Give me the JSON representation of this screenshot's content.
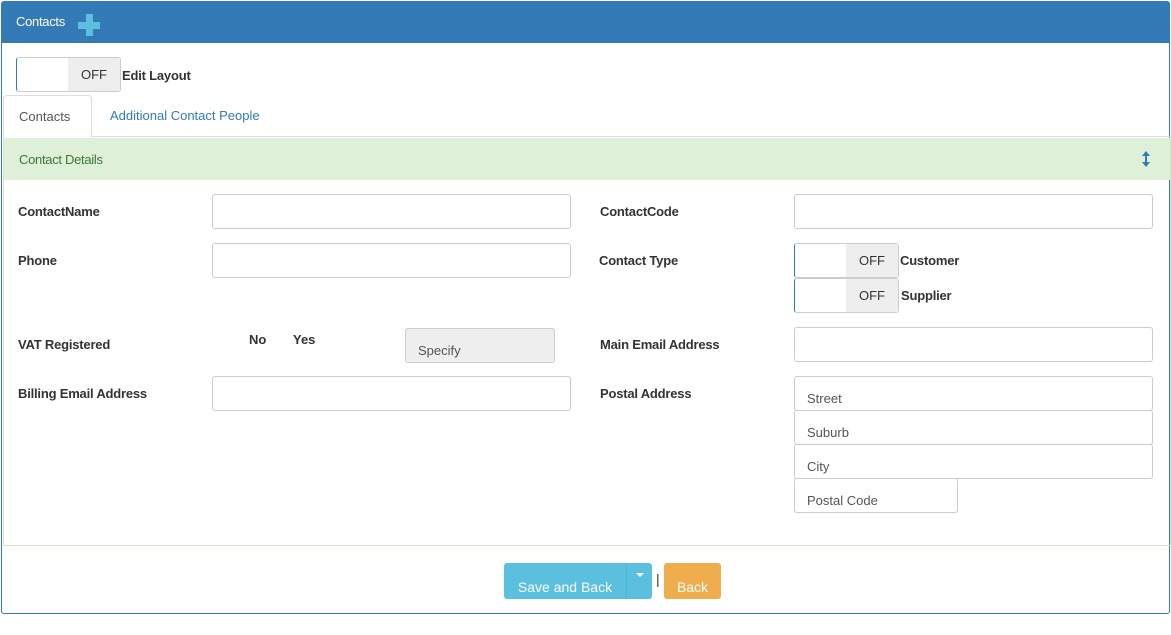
{
  "header": {
    "title": "Contacts",
    "add_icon": "plus-icon"
  },
  "edit_layout": {
    "state": "OFF",
    "label": "Edit Layout"
  },
  "tabs": [
    {
      "label": "Contacts",
      "active": true
    },
    {
      "label": "Additional Contact People",
      "active": false
    }
  ],
  "section": {
    "title": "Contact Details",
    "toggle_icon": "resize-vertical-icon"
  },
  "form": {
    "contact_name": {
      "label": "ContactName",
      "value": ""
    },
    "contact_code": {
      "label": "ContactCode",
      "value": ""
    },
    "phone": {
      "label": "Phone",
      "value": ""
    },
    "contact_type": {
      "label": "Contact Type",
      "customer": {
        "state": "OFF",
        "label": "Customer"
      },
      "supplier": {
        "state": "OFF",
        "label": "Supplier"
      }
    },
    "vat_registered": {
      "label": "VAT Registered",
      "no_label": "No",
      "yes_label": "Yes",
      "specify_placeholder": "Specify"
    },
    "main_email": {
      "label": "Main Email Address",
      "value": ""
    },
    "billing_email": {
      "label": "Billing Email Address",
      "value": ""
    },
    "postal_address": {
      "label": "Postal Address",
      "street_placeholder": "Street",
      "suburb_placeholder": "Suburb",
      "city_placeholder": "City",
      "postal_code_placeholder": "Postal Code"
    }
  },
  "actions": {
    "save_label": "Save and Back",
    "separator": "|",
    "back_label": "Back"
  },
  "colors": {
    "primary": "#337ab7",
    "info": "#5bc0de",
    "warning": "#f0ad4e",
    "success_bg": "#dff0d8",
    "success_text": "#3c763d"
  }
}
